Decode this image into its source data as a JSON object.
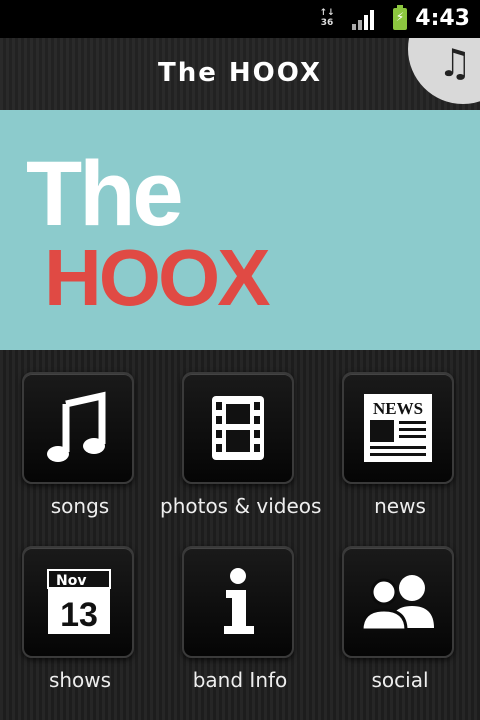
{
  "status_bar": {
    "network": "36",
    "time": "4:43"
  },
  "header": {
    "title": "The HOOX",
    "corner_icon": "music-note-icon"
  },
  "banner": {
    "line1": "The",
    "line2": "HOOX",
    "background": "#8ccbcc",
    "line1_color": "#ffffff",
    "line2_color": "#e04a44"
  },
  "menu": {
    "items": [
      {
        "label": "songs",
        "icon": "music-note-icon"
      },
      {
        "label": "photos & videos",
        "icon": "film-icon"
      },
      {
        "label": "news",
        "icon": "newspaper-icon",
        "icon_text": "NEWS"
      },
      {
        "label": "shows",
        "icon": "calendar-icon",
        "icon_month": "Nov",
        "icon_day": "13"
      },
      {
        "label": "band Info",
        "icon": "info-icon"
      },
      {
        "label": "social",
        "icon": "people-icon"
      }
    ]
  }
}
